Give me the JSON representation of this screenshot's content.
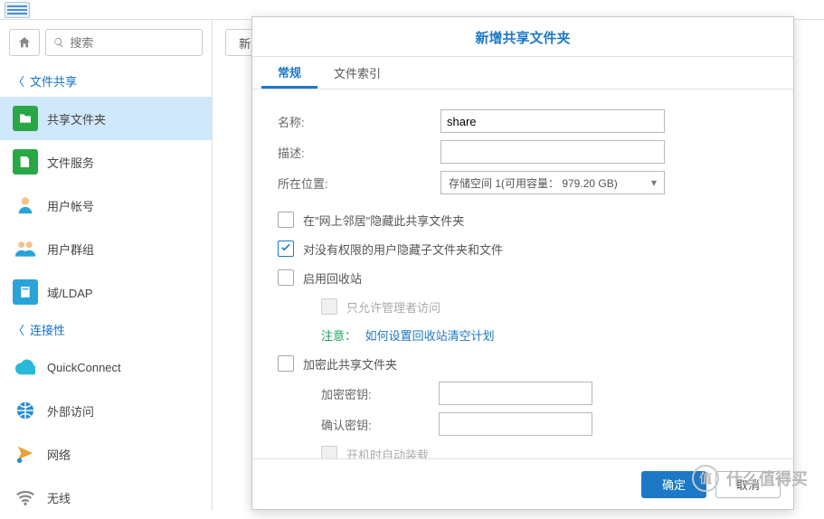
{
  "search": {
    "placeholder": "搜索"
  },
  "sections": {
    "file_sharing": "文件共享",
    "connectivity": "连接性"
  },
  "sidebar": {
    "items": [
      {
        "label": "共享文件夹"
      },
      {
        "label": "文件服务"
      },
      {
        "label": "用户帐号"
      },
      {
        "label": "用户群组"
      },
      {
        "label": "域/LDAP"
      },
      {
        "label": "QuickConnect"
      },
      {
        "label": "外部访问"
      },
      {
        "label": "网络"
      },
      {
        "label": "无线"
      }
    ]
  },
  "toolbar": {
    "new_btn": "新增"
  },
  "dialog": {
    "title": "新增共享文件夹",
    "tabs": {
      "general": "常规",
      "file_index": "文件索引"
    },
    "fields": {
      "name_label": "名称:",
      "name_value": "share",
      "desc_label": "描述:",
      "desc_value": "",
      "location_label": "所在位置:",
      "location_value": "存储空间 1(可用容量： 979.20 GB)"
    },
    "checkboxes": {
      "hide_network": "在\"网上邻居\"隐藏此共享文件夹",
      "hide_no_permission": "对没有权限的用户隐藏子文件夹和文件",
      "enable_recycle": "启用回收站",
      "admin_only": "只允许管理者访问",
      "encrypt": "加密此共享文件夹",
      "auto_mount": "开机时自动装载"
    },
    "hint": {
      "label": "注意：",
      "link": "如何设置回收站清空计划"
    },
    "encryption": {
      "key_label": "加密密钥:",
      "confirm_label": "确认密钥:"
    },
    "buttons": {
      "ok": "确定",
      "cancel": "取消"
    }
  },
  "watermark": {
    "icon_text": "值",
    "text": "什么值得买"
  }
}
